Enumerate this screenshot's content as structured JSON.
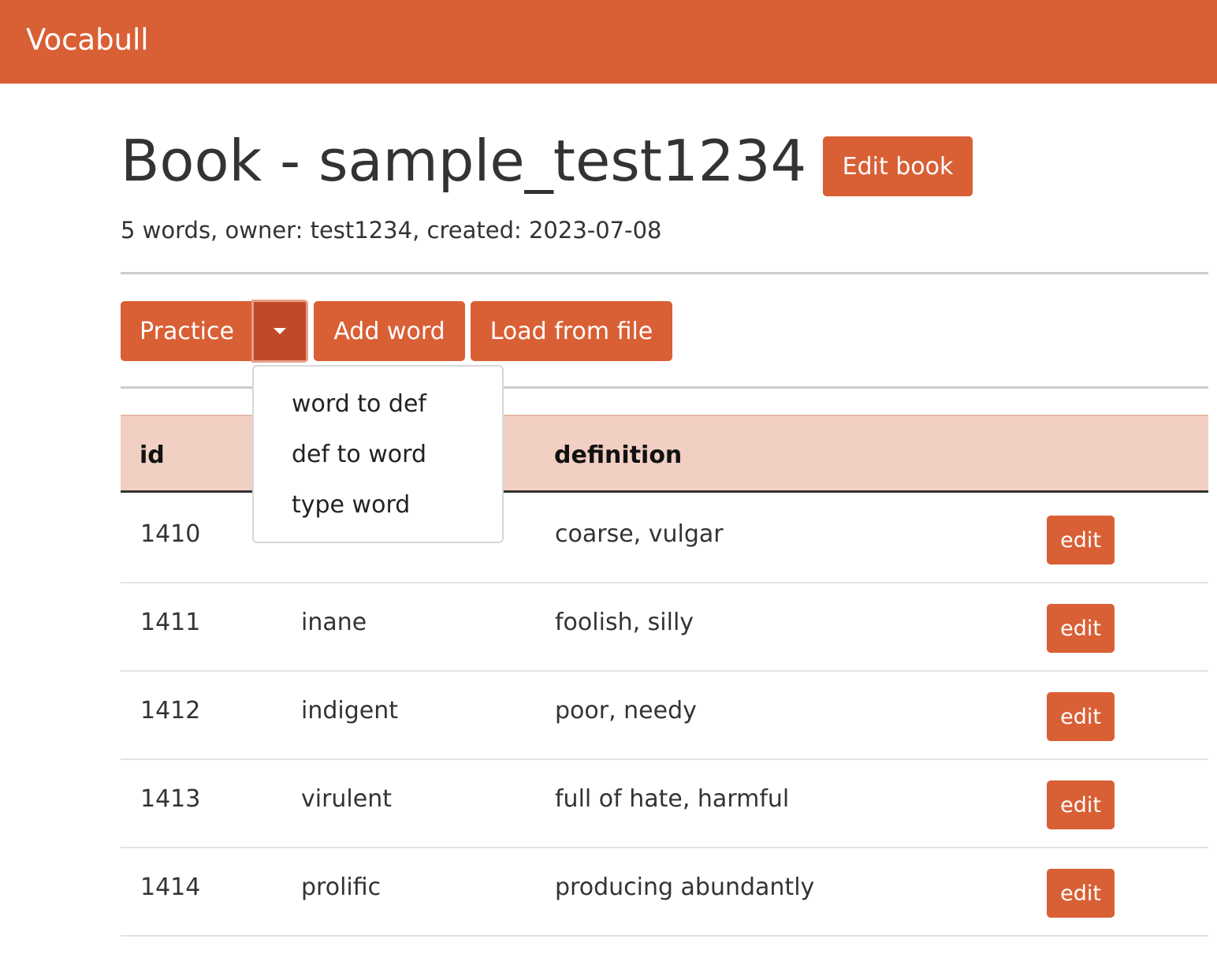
{
  "navbar": {
    "brand": "Vocabull"
  },
  "book": {
    "title": "Book - sample_test1234",
    "edit_label": "Edit book",
    "meta": "5 words, owner: test1234, created: 2023-07-08"
  },
  "toolbar": {
    "practice_label": "Practice",
    "add_word_label": "Add word",
    "load_file_label": "Load from file"
  },
  "practice_menu": {
    "items": [
      "word to def",
      "def to word",
      "type word"
    ]
  },
  "table": {
    "headers": {
      "id": "id",
      "word": "",
      "definition": "definition"
    },
    "edit_label": "edit",
    "rows": [
      {
        "id": "1410",
        "word": "",
        "definition": "coarse, vulgar"
      },
      {
        "id": "1411",
        "word": "inane",
        "definition": "foolish, silly"
      },
      {
        "id": "1412",
        "word": "indigent",
        "definition": "poor, needy"
      },
      {
        "id": "1413",
        "word": "virulent",
        "definition": "full of hate, harmful"
      },
      {
        "id": "1414",
        "word": "prolific",
        "definition": "producing abundantly"
      }
    ]
  },
  "colors": {
    "brand": "#d95f35",
    "brand_dark": "#bf4a27",
    "table_header_bg": "#f2cfc3"
  }
}
